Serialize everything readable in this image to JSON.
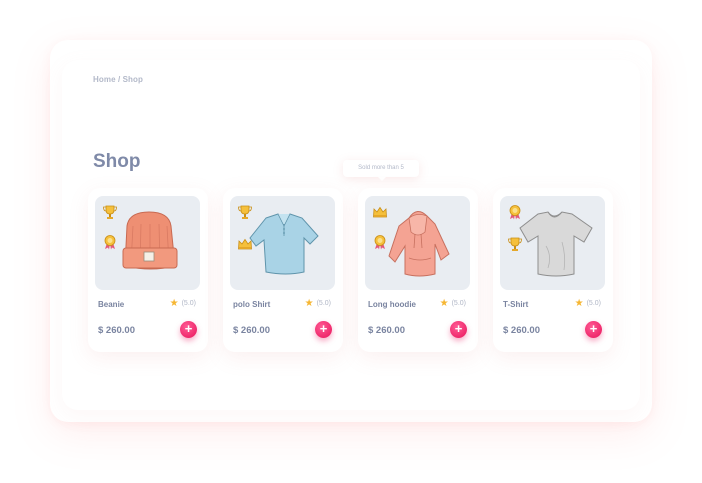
{
  "breadcrumb": "Home / Shop",
  "page_title": "Shop",
  "tooltip": "Sold more than 5",
  "colors": {
    "accent": "#e8145b",
    "title": "#7f8aa8",
    "card_bg": "#e9edf2",
    "star": "#f6b632"
  },
  "products": [
    {
      "name": "Beanie",
      "rating": "(5.0)",
      "price": "$ 260.00",
      "add_label": "+",
      "item": "beanie-icon",
      "badges": [
        "trophy-icon",
        "medal-icon"
      ]
    },
    {
      "name": "polo Shirt",
      "rating": "(5.0)",
      "price": "$ 260.00",
      "add_label": "+",
      "item": "polo-shirt-icon",
      "badges": [
        "trophy-icon",
        "crown-icon"
      ]
    },
    {
      "name": "Long hoodie",
      "rating": "(5.0)",
      "price": "$ 260.00",
      "add_label": "+",
      "item": "hoodie-icon",
      "badges": [
        "crown-icon",
        "medal-icon"
      ]
    },
    {
      "name": "T-Shirt",
      "rating": "(5.0)",
      "price": "$ 260.00",
      "add_label": "+",
      "item": "tshirt-icon",
      "badges": [
        "medal-icon",
        "trophy-icon"
      ]
    }
  ]
}
